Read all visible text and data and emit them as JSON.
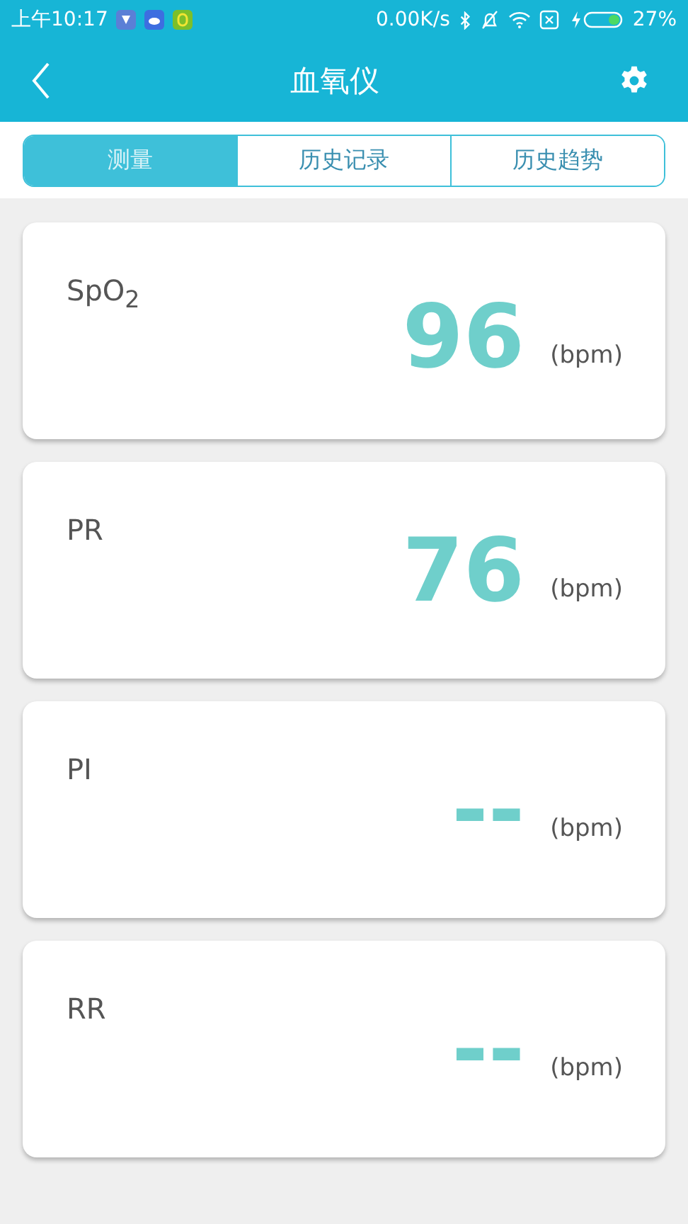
{
  "status_bar": {
    "time": "上午10:17",
    "speed": "0.00K/s",
    "battery": "27%"
  },
  "header": {
    "title": "血氧仪"
  },
  "tabs": [
    {
      "label": "测量",
      "selected": true
    },
    {
      "label": "历史记录",
      "selected": false
    },
    {
      "label": "历史趋势",
      "selected": false
    }
  ],
  "readings": [
    {
      "name": "SpO$_{2}$",
      "value": "96",
      "unit": "(bpm)"
    },
    {
      "name": "PR",
      "value": "76",
      "unit": "(bpm)"
    },
    {
      "name": "PI",
      "value": "--",
      "unit": "(bpm)"
    },
    {
      "name": "RR",
      "value": "--",
      "unit": "(bpm)"
    }
  ]
}
